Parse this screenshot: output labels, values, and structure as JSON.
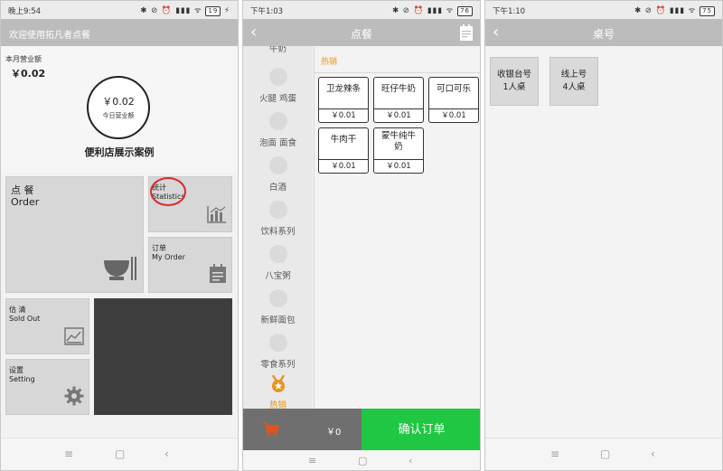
{
  "screen1": {
    "status": {
      "time": "晚上9:54",
      "icons": "✱ ⊘ ⏰ ▮▮▮ ᯤ",
      "battery": "19"
    },
    "banner": "欢迎使用拓凡者点餐",
    "month": {
      "label": "本月营业额",
      "value": "￥0.02"
    },
    "today": {
      "value": "￥0.02",
      "label": "今日营业额"
    },
    "shop_name": "便利店展示案例",
    "tiles": {
      "order": {
        "cn": "点 餐",
        "en": "Order"
      },
      "statistics": {
        "cn": "统计",
        "en": "Statistics"
      },
      "my_order": {
        "cn": "订单",
        "en": "My Order"
      },
      "sold_out": {
        "cn": "估 清",
        "en": "Sold Out"
      },
      "setting": {
        "cn": "设置",
        "en": "Setting"
      }
    },
    "nav": {
      "menu": "≡",
      "home": "▢",
      "back": "‹"
    }
  },
  "screen2": {
    "status": {
      "time": "下午1:03",
      "icons": "✱ ⊘ ⏰ ▮▮▮ ᯤ",
      "battery": "76"
    },
    "title": "点餐",
    "categories_partial": "牛奶",
    "categories": [
      {
        "label": "火腿 鸡蛋"
      },
      {
        "label": "泡面 面食"
      },
      {
        "label": "白酒"
      },
      {
        "label": "饮料系列"
      },
      {
        "label": "八宝粥"
      },
      {
        "label": "新鲜面包"
      },
      {
        "label": "零食系列"
      },
      {
        "label": "热销"
      }
    ],
    "section": "热销",
    "products": [
      {
        "name": "卫龙辣条",
        "price": "￥0.01"
      },
      {
        "name": "旺仔牛奶",
        "price": "￥0.01"
      },
      {
        "name": "可口可乐",
        "price": "￥0.01"
      },
      {
        "name": "牛肉干",
        "price": "￥0.01"
      },
      {
        "name": "蒙牛纯牛奶",
        "price": "￥0.01"
      }
    ],
    "total": "￥0",
    "confirm": "确认订单",
    "nav": {
      "menu": "≡",
      "home": "▢",
      "back": "‹"
    }
  },
  "screen3": {
    "status": {
      "time": "下午1:10",
      "icons": "✱ ⊘ ⏰ ▮▮▮ ᯤ",
      "battery": "75"
    },
    "title": "桌号",
    "tables": [
      {
        "name": "收银台号",
        "size": "1人桌"
      },
      {
        "name": "线上号",
        "size": "4人桌"
      }
    ],
    "nav": {
      "menu": "≡",
      "home": "▢",
      "back": "‹"
    }
  },
  "colors": {
    "accent_green": "#1fc743",
    "hot_orange": "#e89421",
    "highlight_red": "#d92a2a",
    "bar_gray": "#bcbcbc"
  }
}
